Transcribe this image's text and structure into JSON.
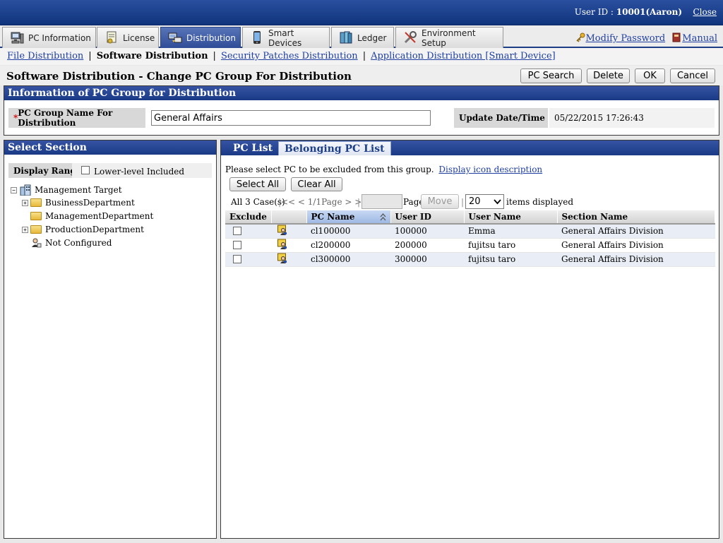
{
  "header": {
    "user_label": "User ID : ",
    "user_value": "10001(Aaron)",
    "close_label": "Close"
  },
  "main_tabs": [
    {
      "label": "PC Information",
      "icon": "pc-icon"
    },
    {
      "label": "License",
      "icon": "license-icon"
    },
    {
      "label": "Distribution",
      "icon": "distribution-icon",
      "active": true
    },
    {
      "label": "Smart Devices",
      "icon": "smartphone-icon"
    },
    {
      "label": "Ledger",
      "icon": "ledger-icon"
    },
    {
      "label": "Environment Setup",
      "icon": "tools-icon"
    }
  ],
  "header_links": {
    "modify_password": "Modify Password",
    "manual": "Manual"
  },
  "subnav": {
    "file_distribution": "File Distribution",
    "software_distribution": "Software Distribution",
    "security_patches": "Security Patches Distribution",
    "application_distribution": "Application Distribution [Smart Device]"
  },
  "page": {
    "title": "Software Distribution - Change PC Group For Distribution",
    "buttons": {
      "pc_search": "PC Search",
      "delete": "Delete",
      "ok": "OK",
      "cancel": "Cancel"
    }
  },
  "info_panel": {
    "title": "Information of PC Group for Distribution",
    "required_mark": "*",
    "group_name_label": "PC Group Name For Distribution",
    "group_name_value": "General Affairs",
    "update_label": "Update Date/Time",
    "update_value": "05/22/2015 17:26:43"
  },
  "section_panel": {
    "title": "Select Section",
    "display_range_label": "Display Range",
    "lower_level_label": "Lower-level Included",
    "tree": {
      "root": "Management Target",
      "items": [
        "BusinessDepartment",
        "ManagementDepartment",
        "ProductionDepartment",
        "Not Configured"
      ]
    }
  },
  "list_panel": {
    "tabs": {
      "pc_list": "PC List",
      "belonging_pc_list": "Belonging PC List"
    },
    "instruction": "Please select PC to be excluded from this group.",
    "icon_link": "Display icon description",
    "select_all": "Select All",
    "clear_all": "Clear All",
    "pager": {
      "count": "All 3 Case(s)",
      "nav": "<< < 1/1Page > >>",
      "page_label": "Page",
      "move": "Move",
      "per_page": "20",
      "items_label": "items displayed"
    },
    "columns": [
      "Exclude",
      "",
      "PC Name",
      "User ID",
      "User Name",
      "Section Name"
    ],
    "rows": [
      {
        "pc_name": "cl100000",
        "user_id": "100000",
        "user_name": "Emma",
        "section": "General Affairs Division"
      },
      {
        "pc_name": "cl200000",
        "user_id": "200000",
        "user_name": "fujitsu taro",
        "section": "General Affairs Division"
      },
      {
        "pc_name": "cl300000",
        "user_id": "300000",
        "user_name": "fujitsu taro",
        "section": "General Affairs Division"
      }
    ]
  },
  "colors": {
    "brand_blue": "#1c3f88",
    "link": "#1f3fa0",
    "required": "#d00000"
  }
}
